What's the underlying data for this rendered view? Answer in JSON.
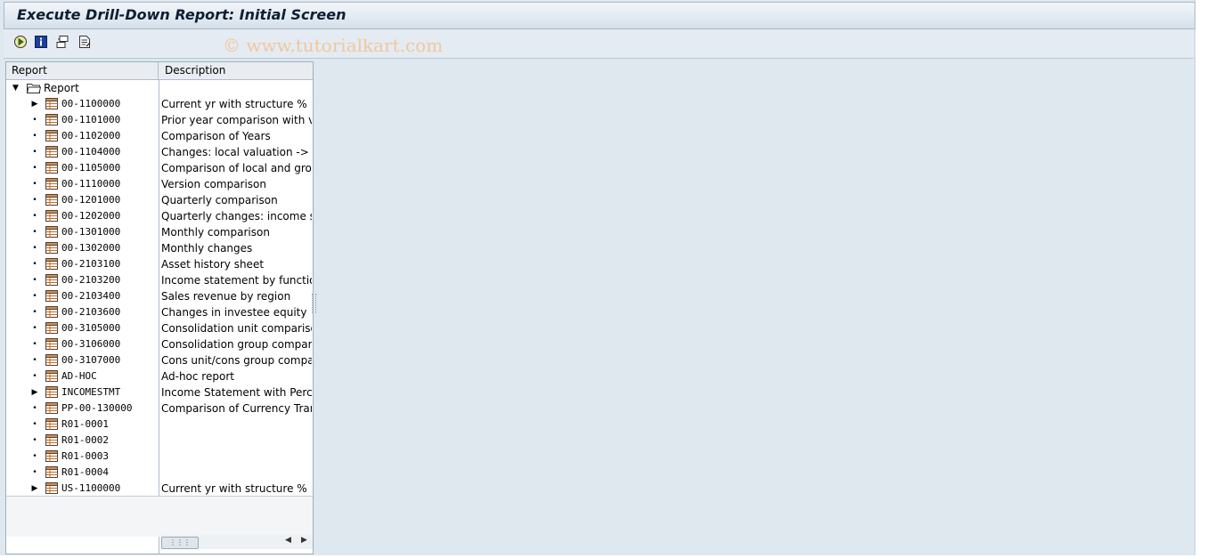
{
  "window": {
    "title": "Execute Drill-Down Report: Initial Screen"
  },
  "toolbar": {
    "buttons": [
      {
        "name": "execute-icon"
      },
      {
        "name": "info-icon"
      },
      {
        "name": "hierarchy-icon"
      },
      {
        "name": "report-list-icon"
      }
    ],
    "watermark": "© www.tutorialkart.com"
  },
  "tree": {
    "headers": {
      "report": "Report",
      "description": "Description"
    },
    "root_label": "Report",
    "items": [
      {
        "code": "00-1100000",
        "desc": "Current yr with structure % : E",
        "expandable": true
      },
      {
        "code": "00-1101000",
        "desc": "Prior year comparison with varia",
        "expandable": false
      },
      {
        "code": "00-1102000",
        "desc": "Comparison of Years",
        "expandable": false
      },
      {
        "code": "00-1104000",
        "desc": "Changes: local valuation -> con",
        "expandable": false
      },
      {
        "code": "00-1105000",
        "desc": "Comparison of local and group",
        "expandable": false
      },
      {
        "code": "00-1110000",
        "desc": "Version comparison",
        "expandable": false
      },
      {
        "code": "00-1201000",
        "desc": "Quarterly comparison",
        "expandable": false
      },
      {
        "code": "00-1202000",
        "desc": "Quarterly changes: income stat",
        "expandable": false
      },
      {
        "code": "00-1301000",
        "desc": "Monthly comparison",
        "expandable": false
      },
      {
        "code": "00-1302000",
        "desc": "Monthly changes",
        "expandable": false
      },
      {
        "code": "00-2103100",
        "desc": "Asset history sheet",
        "expandable": false
      },
      {
        "code": "00-2103200",
        "desc": "Income statement by functions",
        "expandable": false
      },
      {
        "code": "00-2103400",
        "desc": "Sales revenue by region",
        "expandable": false
      },
      {
        "code": "00-2103600",
        "desc": "Changes in investee equity",
        "expandable": false
      },
      {
        "code": "00-3105000",
        "desc": "Consolidation unit comparison",
        "expandable": false
      },
      {
        "code": "00-3106000",
        "desc": "Consolidation group comparison",
        "expandable": false
      },
      {
        "code": "00-3107000",
        "desc": "Cons unit/cons group comparis",
        "expandable": false
      },
      {
        "code": "AD-HOC",
        "desc": "Ad-hoc report",
        "expandable": false
      },
      {
        "code": "INCOMESTMT",
        "desc": "Income Statement with Percen",
        "expandable": true
      },
      {
        "code": "PP-00-130000",
        "desc": "Comparison of Currency Transla",
        "expandable": false
      },
      {
        "code": "R01-0001",
        "desc": "",
        "expandable": false
      },
      {
        "code": "R01-0002",
        "desc": "",
        "expandable": false
      },
      {
        "code": "R01-0003",
        "desc": "",
        "expandable": false
      },
      {
        "code": "R01-0004",
        "desc": "",
        "expandable": false
      },
      {
        "code": "US-1100000",
        "desc": "Current yr with structure % : E",
        "expandable": true
      }
    ]
  },
  "colors": {
    "title_text": "#0c1f33",
    "background": "#dfe7ef",
    "watermark": "#f1c79d"
  }
}
